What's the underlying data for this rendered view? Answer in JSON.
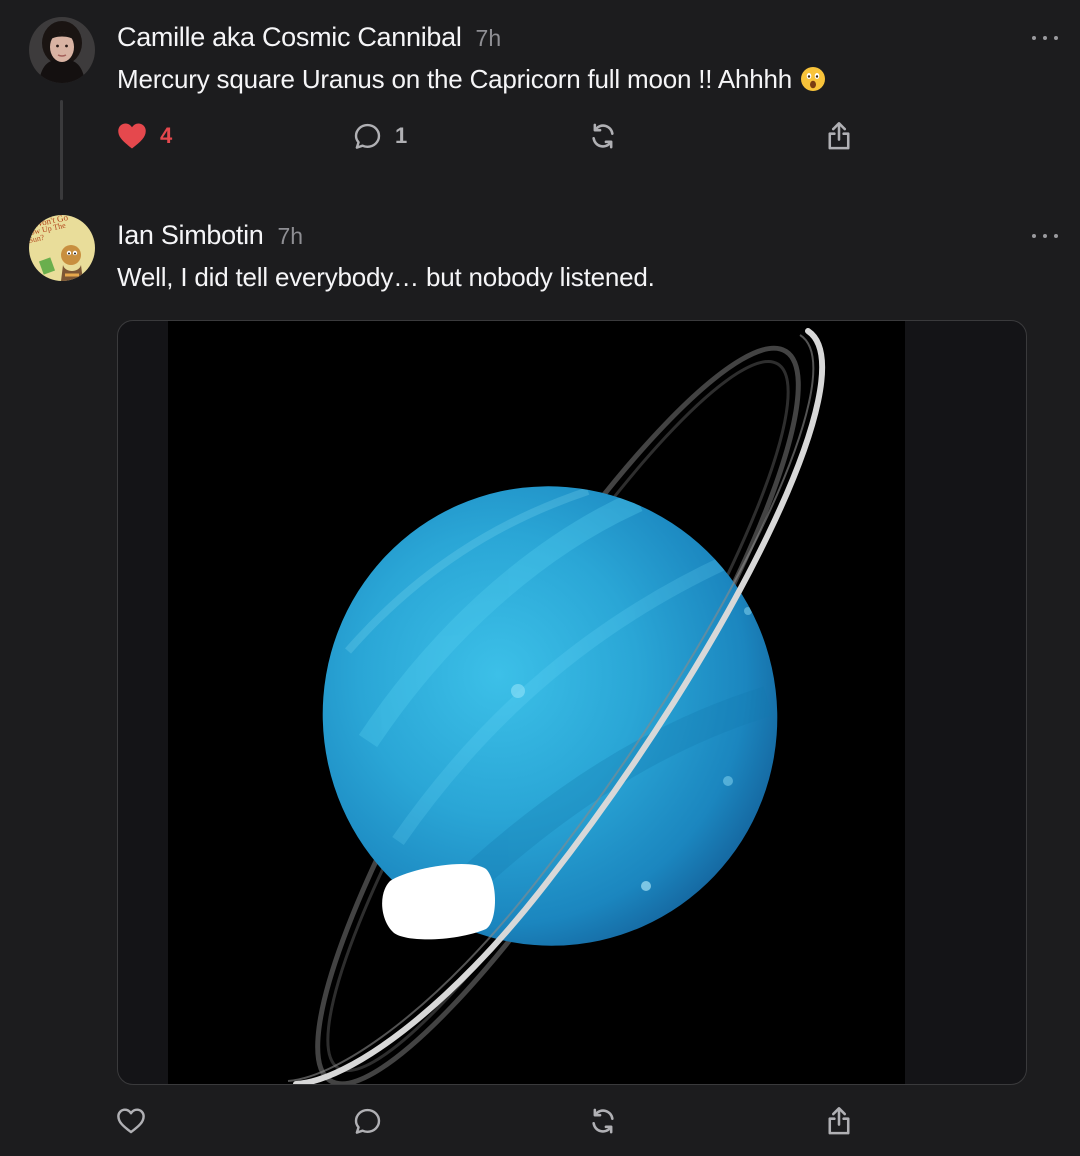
{
  "posts": [
    {
      "author": "Camille aka Cosmic Cannibal",
      "time": "7h",
      "text": "Mercury square Uranus on the Capricorn full moon !! Ahhhh",
      "emoji": "astonished-face-emoji",
      "likes": "4",
      "liked": true,
      "replies": "1"
    },
    {
      "author": "Ian Simbotin",
      "time": "7h",
      "text": "Well, I did tell everybody… but nobody listened.",
      "media": "uranus-planet-photo",
      "avatar_text": "Won't Gow Up The Sun?"
    }
  ],
  "colors": {
    "background": "#1c1c1e",
    "like_red": "#e5484d",
    "muted": "#8e8e93",
    "planet_blue": "#2aa6d6"
  },
  "icons": [
    "heart-icon",
    "comment-icon",
    "repost-icon",
    "share-icon",
    "more-icon"
  ]
}
